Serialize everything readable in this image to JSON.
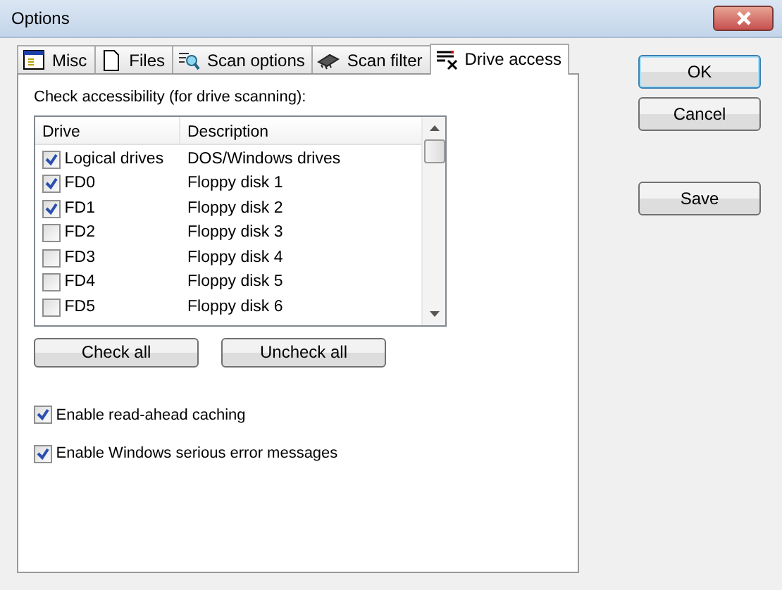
{
  "window": {
    "title": "Options"
  },
  "tabs": [
    {
      "label": "Misc",
      "selected": false
    },
    {
      "label": "Files",
      "selected": false
    },
    {
      "label": "Scan options",
      "selected": false
    },
    {
      "label": "Scan filter",
      "selected": false
    },
    {
      "label": "Drive access",
      "selected": true
    }
  ],
  "panel": {
    "caption": "Check accessibility (for drive scanning):",
    "table": {
      "columns": [
        "Drive",
        "Description"
      ],
      "rows": [
        {
          "drive": "Logical drives",
          "description": "DOS/Windows drives",
          "checked": true
        },
        {
          "drive": "FD0",
          "description": "Floppy disk 1",
          "checked": true
        },
        {
          "drive": "FD1",
          "description": "Floppy disk 2",
          "checked": true
        },
        {
          "drive": "FD2",
          "description": "Floppy disk 3",
          "checked": false
        },
        {
          "drive": "FD3",
          "description": "Floppy disk 4",
          "checked": false
        },
        {
          "drive": "FD4",
          "description": "Floppy disk 5",
          "checked": false
        },
        {
          "drive": "FD5",
          "description": "Floppy disk 6",
          "checked": false
        }
      ]
    },
    "list_buttons": [
      "Check all",
      "Uncheck all"
    ],
    "options": [
      {
        "label": "Enable read-ahead caching",
        "checked": true
      },
      {
        "label": "Enable Windows serious error messages",
        "checked": true
      }
    ]
  },
  "buttons": [
    {
      "label": "OK",
      "default": true
    },
    {
      "label": "Cancel",
      "default": false
    },
    {
      "label": "Save",
      "default": false
    }
  ]
}
